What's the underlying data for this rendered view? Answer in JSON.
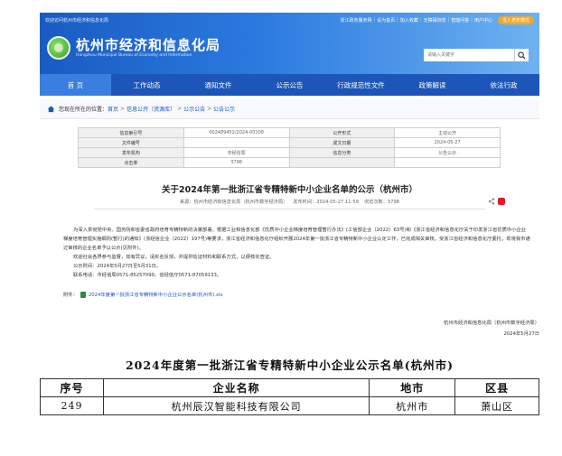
{
  "header": {
    "welcome": "欢迎访问杭州市经济和信息化局",
    "toplinks": [
      "浙江政务服务网",
      "设为首页",
      "加入收藏",
      "无障碍浏览",
      "智能问答",
      "用户中心"
    ],
    "elder_mode": "进入老年模式",
    "logo_cn": "杭州市经济和信息化局",
    "logo_en": "Hangzhou Municipal Bureau of Economy and Information",
    "search_placeholder": "请输入关键字"
  },
  "nav": {
    "items": [
      "首 页",
      "工作动态",
      "通知文件",
      "公示公告",
      "行政规范性文件",
      "政策解读",
      "依法行政"
    ],
    "active_index": 0
  },
  "breadcrumb": {
    "prefix": "您现在所在的位置：",
    "items": [
      "首页",
      "信息公开（资源库）",
      "公示公告",
      "公告公示"
    ]
  },
  "meta": {
    "rows": [
      {
        "k1": "信息索引号",
        "v1": "002489452/2024-00108",
        "k2": "公开形式",
        "v2": "主动公开"
      },
      {
        "k1": "文件编号",
        "v1": "",
        "k2": "成文日期",
        "v2": "2024-05-27"
      },
      {
        "k1": "发布机构",
        "v1": "市经信局",
        "k2": "信息分类",
        "v2": "公告公示"
      },
      {
        "k1": "点击率",
        "v1": "3798",
        "k2": "",
        "v2": ""
      }
    ]
  },
  "article": {
    "title": "关于2024年第一批浙江省专精特新中小企业名单的公示（杭州市）",
    "source": "来源：杭州市经济和信息化局（杭州市数字经济局）",
    "publish_time": "发布时间：2024-05-27 11:59",
    "views": "浏览次数：3798",
    "para1": "为深入贯彻党中央、国务院和省委省政府培育专精特新的决策部署，根据工业和信息化部《优质中小企业梯度培育管理暂行办法》(工信部企业〔2022〕63号)和《浙江省经济和信息化厅关于印发浙江省优质中小企业梯度培育管理实施细则(暂行)的通知》(浙经信企业〔2022〕197号)等要求，浙江省经济和信息化厅组织开展2024年第一批浙江省专精特新中小企业认定工作，已完成相关审核。受浙江省经济和信息化厅委托，现将我市通过审核的企业名单予以公示(见附件)。",
    "para2": "欢迎社会各界参与监督，如有异议，请实名反馈，并提供佐证材料和联系方式，以便核实查证。",
    "para3": "公示时间：2024年5月27日至5月31日。",
    "para4": "联系电话：市经信局0571-85257090、省经信厅0571-87059133。",
    "attach_label": "附件：",
    "attach_name": "2024年度第一批浙江省专精特新中小企业公示名单(杭州市).xls",
    "sign_org": "杭州市经济和信息化局（杭州市数字经济局）",
    "sign_date": "2024年5月27日"
  },
  "list": {
    "title": "2024年度第一批浙江省专精特新中小企业公示名单(杭州市)",
    "headers": [
      "序号",
      "企业名称",
      "地市",
      "区县"
    ],
    "rows": [
      [
        "249",
        "杭州辰汉智能科技有限公司",
        "杭州市",
        "萧山区"
      ]
    ]
  }
}
